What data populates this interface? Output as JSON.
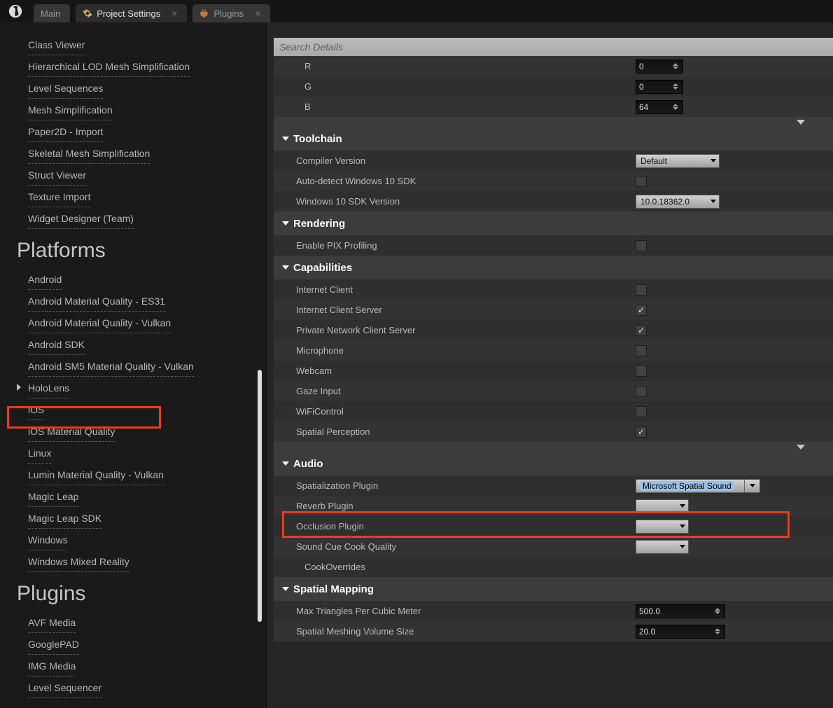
{
  "tabs": [
    {
      "label": "Main"
    },
    {
      "label": "Project Settings"
    },
    {
      "label": "Plugins"
    }
  ],
  "search": {
    "placeholder": "Search Details"
  },
  "sidebar": {
    "editors": [
      "Class Viewer",
      "Hierarchical LOD Mesh Simplification",
      "Level Sequences",
      "Mesh Simplification",
      "Paper2D - Import",
      "Skeletal Mesh Simplification",
      "Struct Viewer",
      "Texture Import",
      "Widget Designer (Team)"
    ],
    "platforms_header": "Platforms",
    "platforms": [
      "Android",
      "Android Material Quality - ES31",
      "Android Material Quality - Vulkan",
      "Android SDK",
      "Android SM5 Material Quality - Vulkan",
      "HoloLens",
      "iOS",
      "iOS Material Quality",
      "Linux",
      "Lumin Material Quality - Vulkan",
      "Magic Leap",
      "Magic Leap SDK",
      "Windows",
      "Windows Mixed Reality"
    ],
    "plugins_header": "Plugins",
    "plugins": [
      "AVF Media",
      "GooglePAD",
      "IMG Media",
      "Level Sequencer"
    ]
  },
  "details": {
    "rgb": {
      "r_label": "R",
      "r": "0",
      "g_label": "G",
      "g": "0",
      "b_label": "B",
      "b": "64"
    },
    "toolchain": {
      "header": "Toolchain",
      "compiler_label": "Compiler Version",
      "compiler": "Default",
      "autodetect_label": "Auto-detect Windows 10 SDK",
      "sdk_label": "Windows 10 SDK Version",
      "sdk": "10.0.18362.0"
    },
    "rendering": {
      "header": "Rendering",
      "pix_label": "Enable PIX Profiling"
    },
    "capabilities": {
      "header": "Capabilities",
      "items": [
        {
          "label": "Internet Client",
          "checked": false
        },
        {
          "label": "Internet Client Server",
          "checked": true
        },
        {
          "label": "Private Network Client Server",
          "checked": true
        },
        {
          "label": "Microphone",
          "checked": false
        },
        {
          "label": "Webcam",
          "checked": false
        },
        {
          "label": "Gaze Input",
          "checked": false
        },
        {
          "label": "WiFiControl",
          "checked": false
        },
        {
          "label": "Spatial Perception",
          "checked": true
        }
      ]
    },
    "audio": {
      "header": "Audio",
      "spat_label": "Spatialization Plugin",
      "spat": "Microsoft Spatial Sound",
      "reverb_label": "Reverb Plugin",
      "occl_label": "Occlusion Plugin",
      "cook_label": "Sound Cue Cook Quality",
      "override_label": "CookOverrides"
    },
    "spatial_mapping": {
      "header": "Spatial Mapping",
      "tri_label": "Max Triangles Per Cubic Meter",
      "tri": "500.0",
      "vol_label": "Spatial Meshing Volume Size",
      "vol": "20.0"
    }
  }
}
